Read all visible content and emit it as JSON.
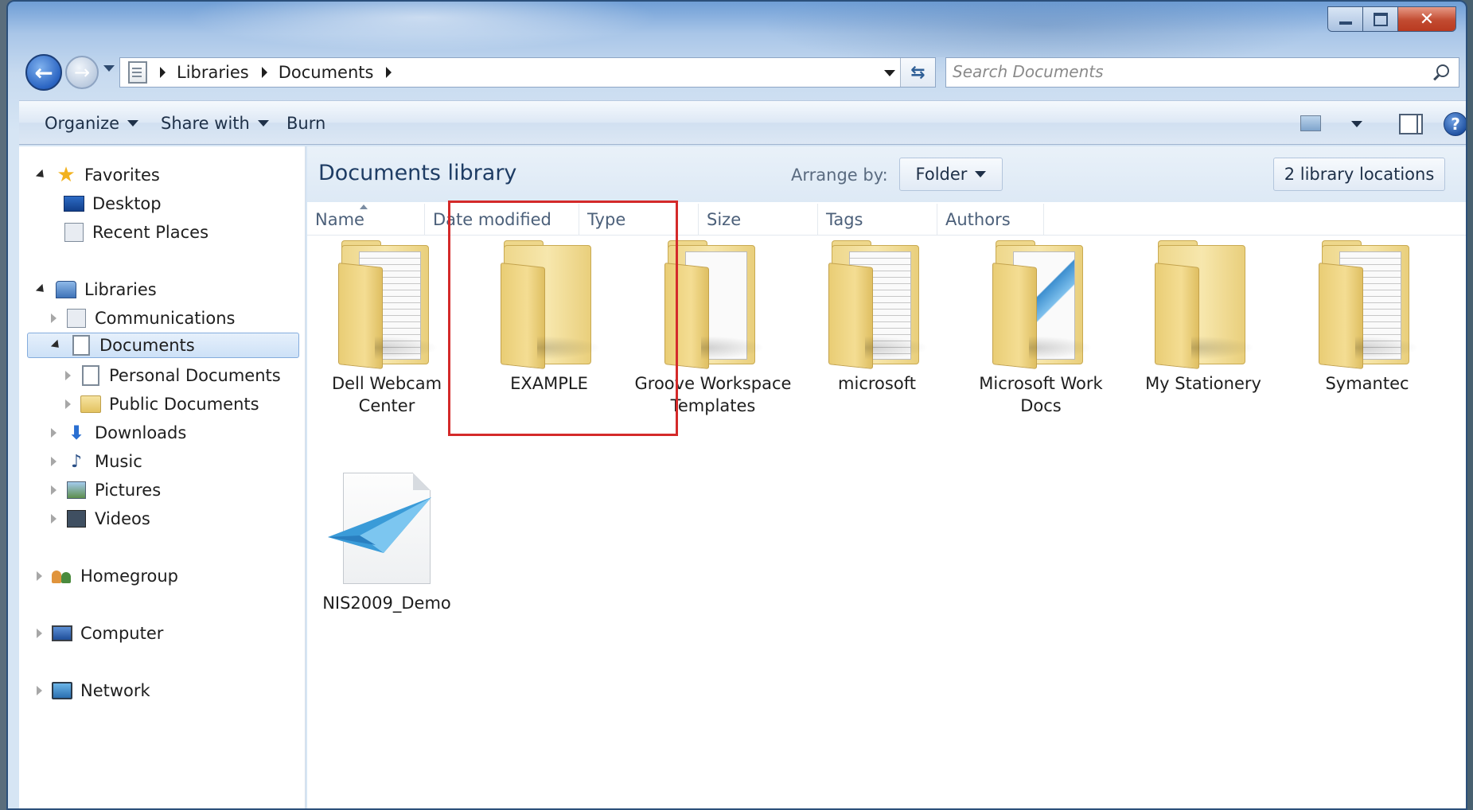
{
  "window": {
    "caption_buttons": [
      "minimize",
      "maximize",
      "close"
    ]
  },
  "address": {
    "breadcrumbs": [
      "Libraries",
      "Documents"
    ],
    "search_placeholder": "Search Documents"
  },
  "toolbar": {
    "organize": "Organize",
    "share_with": "Share with",
    "burn": "Burn"
  },
  "navpane": {
    "favorites": "Favorites",
    "desktop": "Desktop",
    "recent_places": "Recent Places",
    "libraries": "Libraries",
    "communications": "Communications",
    "documents": "Documents",
    "personal_documents": "Personal Documents",
    "public_documents": "Public Documents",
    "downloads": "Downloads",
    "music": "Music",
    "pictures": "Pictures",
    "videos": "Videos",
    "homegroup": "Homegroup",
    "computer": "Computer",
    "network": "Network"
  },
  "library": {
    "title": "Documents library",
    "arrange_label": "Arrange by:",
    "arrange_value": "Folder",
    "locations": "2 library locations"
  },
  "columns": [
    "Name",
    "Date modified",
    "Type",
    "Size",
    "Tags",
    "Authors"
  ],
  "items": [
    {
      "label": "Dell Webcam Center",
      "icon": "folder-lines-icon"
    },
    {
      "label": "EXAMPLE",
      "icon": "folder-empty-icon"
    },
    {
      "label": "Groove Workspace Templates",
      "icon": "folder-paper-icon"
    },
    {
      "label": "microsoft",
      "icon": "folder-lines-icon"
    },
    {
      "label": "Microsoft Work Docs",
      "icon": "folder-blue-doc-icon"
    },
    {
      "label": "My Stationery",
      "icon": "folder-empty-icon"
    },
    {
      "label": "Symantec",
      "icon": "folder-lines-icon"
    },
    {
      "label": "NIS2009_Demo",
      "icon": "nis-document-icon"
    }
  ],
  "highlight_color": "#d42a2a"
}
